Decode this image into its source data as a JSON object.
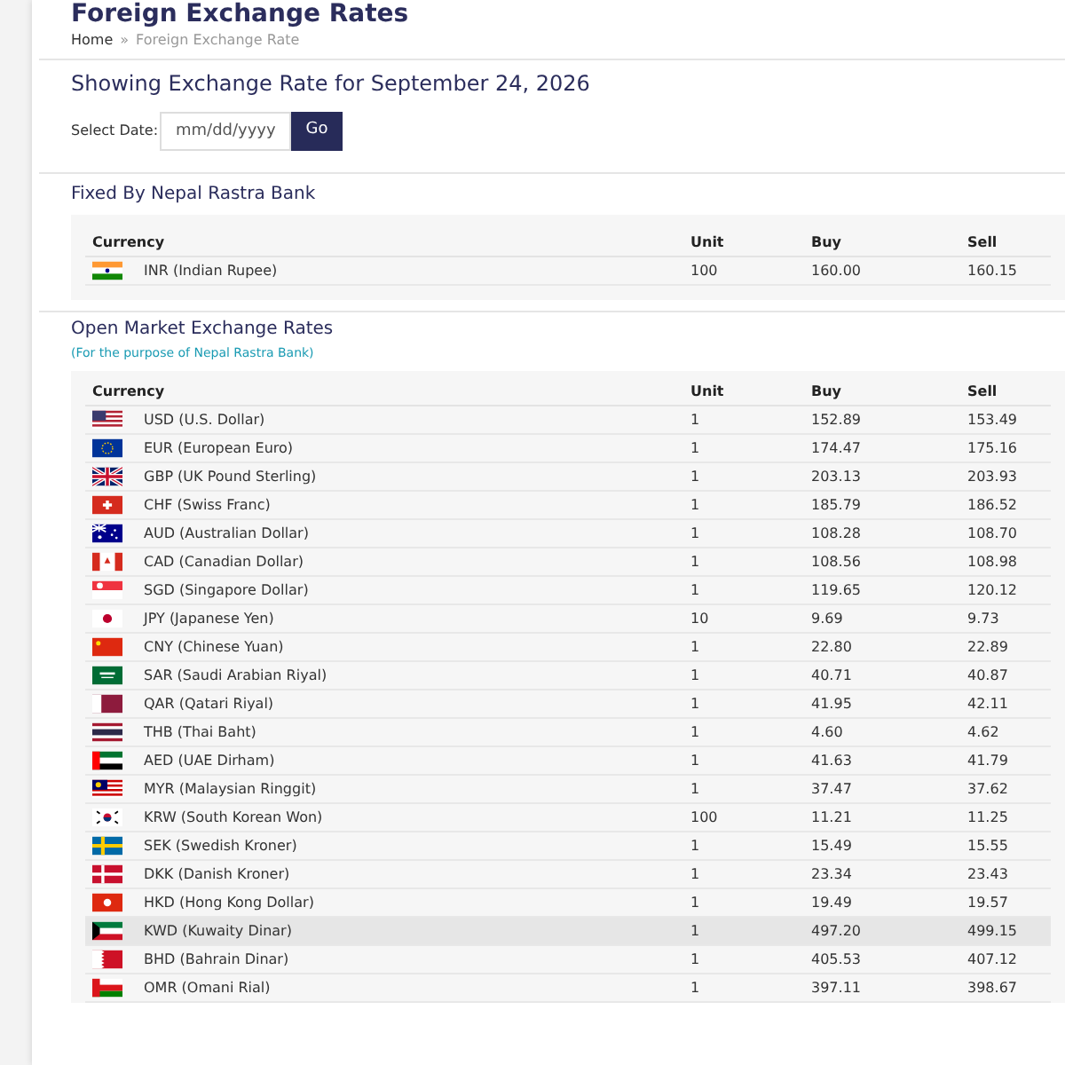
{
  "page_title": "Foreign Exchange Rates",
  "breadcrumb": {
    "home": "Home",
    "separator": "»",
    "current": "Foreign Exchange Rate"
  },
  "heading": "Showing Exchange Rate for September 24, 2026",
  "date_form": {
    "label": "Select Date:",
    "placeholder": "mm/dd/yyyy",
    "button": "Go"
  },
  "fixed": {
    "title": "Fixed By Nepal Rastra Bank",
    "columns": [
      "Currency",
      "Unit",
      "Buy",
      "Sell"
    ],
    "rows": [
      {
        "currency": "INR (Indian Rupee)",
        "unit": "100",
        "buy": "160.00",
        "sell": "160.15",
        "highlighted": false
      }
    ]
  },
  "open_market": {
    "title": "Open Market Exchange Rates",
    "subtitle": "(For the purpose of Nepal Rastra Bank)",
    "columns": [
      "Currency",
      "Unit",
      "Buy",
      "Sell"
    ],
    "rows": [
      {
        "currency": "USD (U.S. Dollar)",
        "unit": "1",
        "buy": "152.89",
        "sell": "153.49",
        "highlighted": false
      },
      {
        "currency": "EUR (European Euro)",
        "unit": "1",
        "buy": "174.47",
        "sell": "175.16",
        "highlighted": false
      },
      {
        "currency": "GBP (UK Pound Sterling)",
        "unit": "1",
        "buy": "203.13",
        "sell": "203.93",
        "highlighted": false
      },
      {
        "currency": "CHF (Swiss Franc)",
        "unit": "1",
        "buy": "185.79",
        "sell": "186.52",
        "highlighted": false
      },
      {
        "currency": "AUD (Australian Dollar)",
        "unit": "1",
        "buy": "108.28",
        "sell": "108.70",
        "highlighted": false
      },
      {
        "currency": "CAD (Canadian Dollar)",
        "unit": "1",
        "buy": "108.56",
        "sell": "108.98",
        "highlighted": false
      },
      {
        "currency": "SGD (Singapore Dollar)",
        "unit": "1",
        "buy": "119.65",
        "sell": "120.12",
        "highlighted": false
      },
      {
        "currency": "JPY (Japanese Yen)",
        "unit": "10",
        "buy": "9.69",
        "sell": "9.73",
        "highlighted": false
      },
      {
        "currency": "CNY (Chinese Yuan)",
        "unit": "1",
        "buy": "22.80",
        "sell": "22.89",
        "highlighted": false
      },
      {
        "currency": "SAR (Saudi Arabian Riyal)",
        "unit": "1",
        "buy": "40.71",
        "sell": "40.87",
        "highlighted": false
      },
      {
        "currency": "QAR (Qatari Riyal)",
        "unit": "1",
        "buy": "41.95",
        "sell": "42.11",
        "highlighted": false
      },
      {
        "currency": "THB (Thai Baht)",
        "unit": "1",
        "buy": "4.60",
        "sell": "4.62",
        "highlighted": false
      },
      {
        "currency": "AED (UAE Dirham)",
        "unit": "1",
        "buy": "41.63",
        "sell": "41.79",
        "highlighted": false
      },
      {
        "currency": "MYR (Malaysian Ringgit)",
        "unit": "1",
        "buy": "37.47",
        "sell": "37.62",
        "highlighted": false
      },
      {
        "currency": "KRW (South Korean Won)",
        "unit": "100",
        "buy": "11.21",
        "sell": "11.25",
        "highlighted": false
      },
      {
        "currency": "SEK (Swedish Kroner)",
        "unit": "1",
        "buy": "15.49",
        "sell": "15.55",
        "highlighted": false
      },
      {
        "currency": "DKK (Danish Kroner)",
        "unit": "1",
        "buy": "23.34",
        "sell": "23.43",
        "highlighted": false
      },
      {
        "currency": "HKD (Hong Kong Dollar)",
        "unit": "1",
        "buy": "19.49",
        "sell": "19.57",
        "highlighted": false
      },
      {
        "currency": "KWD (Kuwaity Dinar)",
        "unit": "1",
        "buy": "497.20",
        "sell": "499.15",
        "highlighted": true
      },
      {
        "currency": "BHD (Bahrain Dinar)",
        "unit": "1",
        "buy": "405.53",
        "sell": "407.12",
        "highlighted": false
      },
      {
        "currency": "OMR (Omani Rial)",
        "unit": "1",
        "buy": "397.11",
        "sell": "398.67",
        "highlighted": false
      }
    ]
  }
}
